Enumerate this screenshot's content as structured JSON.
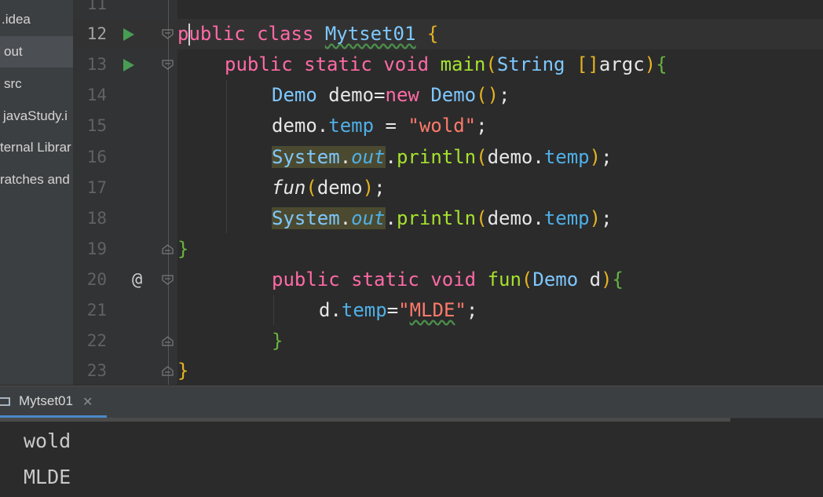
{
  "sidebar": {
    "items": [
      {
        "label": ".idea"
      },
      {
        "label": "out"
      },
      {
        "label": "src"
      },
      {
        "label": "javaStudy.i"
      },
      {
        "label": "ternal Librar"
      },
      {
        "label": "ratches and"
      }
    ]
  },
  "editor": {
    "line_numbers": [
      "11",
      "12",
      "13",
      "14",
      "15",
      "16",
      "17",
      "18",
      "19",
      "20",
      "21",
      "22",
      "23"
    ],
    "gutter_at": "@",
    "tokens": {
      "public": "public",
      "class": "class",
      "classname": "Mytset01",
      "lbrace": "{",
      "rbrace": "}",
      "static": "static",
      "void": "void",
      "main": "main",
      "lparen": "(",
      "rparen": ")",
      "String": "String",
      "brackets": "[]",
      "argc": "argc",
      "Demo": "Demo",
      "demo_decl": " demo=",
      "new": "new",
      "semi": ";",
      "demo": "demo",
      "dot": ".",
      "temp": "temp",
      "assign": " = ",
      "wold": "\"wold\"",
      "System": "System",
      "out": "out",
      "println": "println",
      "fun": "fun",
      "d": " d",
      "d_plain": "d",
      "eq": "=",
      "quote": "\"",
      "MLDE": "MLDE"
    }
  },
  "run_panel": {
    "tab_label": "Mytset01",
    "close": "✕",
    "output": [
      "wold",
      "MLDE"
    ]
  },
  "colors": {
    "keyword": "#ff6aa6",
    "type": "#7ec8ff",
    "method": "#a6e22e",
    "field": "#4fb0e8",
    "string": "#ff7a6b",
    "paren": "#e6b422",
    "brace": "#69b33f",
    "run_icon": "#499c54"
  },
  "icons": [
    "run-icon",
    "override-at-icon",
    "fold-icon",
    "console-icon",
    "close-icon"
  ]
}
